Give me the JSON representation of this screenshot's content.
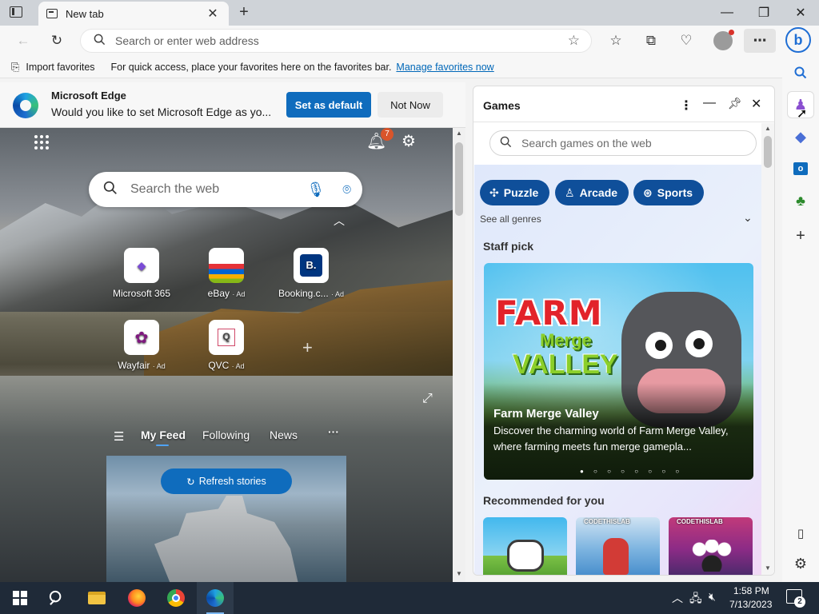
{
  "tabs": [
    {
      "title": "New tab"
    }
  ],
  "toolbar": {
    "address_placeholder": "Search or enter web address"
  },
  "favorites_bar": {
    "import_label": "Import favorites",
    "message": "For quick access, place your favorites here on the favorites bar.",
    "manage_link": "Manage favorites now"
  },
  "default_banner": {
    "title": "Microsoft Edge",
    "message": "Would you like to set Microsoft Edge as yo...",
    "primary_button": "Set as default",
    "secondary_button": "Not Now"
  },
  "ntp": {
    "notification_count": "7",
    "search_placeholder": "Search the web",
    "quick_links": [
      {
        "label": "Microsoft 365",
        "ad": ""
      },
      {
        "label": "eBay",
        "ad": "· Ad"
      },
      {
        "label": "Booking.c...",
        "ad": "· Ad"
      },
      {
        "label": "Wayfair",
        "ad": "· Ad"
      },
      {
        "label": "QVC",
        "ad": "· Ad"
      }
    ],
    "feed_tabs": [
      "My Feed",
      "Following",
      "News"
    ],
    "refresh_label": "Refresh stories"
  },
  "games": {
    "title": "Games",
    "search_placeholder": "Search games on the web",
    "genres": [
      "Puzzle",
      "Arcade",
      "Sports"
    ],
    "see_all": "See all genres",
    "staff_pick_heading": "Staff pick",
    "staff_pick": {
      "title": "Farm Merge Valley",
      "description": "Discover the charming world of Farm Merge Valley, where farming meets fun merge gamepla...",
      "art_line1": "FARM",
      "art_line2": "Merge",
      "art_line3": "VALLEY"
    },
    "recommended_heading": "Recommended for you",
    "recommended_badges": [
      "",
      "CODETHISLAB",
      "CODETHISLAB"
    ]
  },
  "taskbar": {
    "time": "1:58 PM",
    "date": "7/13/2023",
    "notification_count": "2"
  },
  "colors": {
    "accent": "#0f6cbd",
    "banner_bg": "#f7f7f7",
    "taskbar": "#1f2a38",
    "genre_pill": "#0f4f9a"
  }
}
